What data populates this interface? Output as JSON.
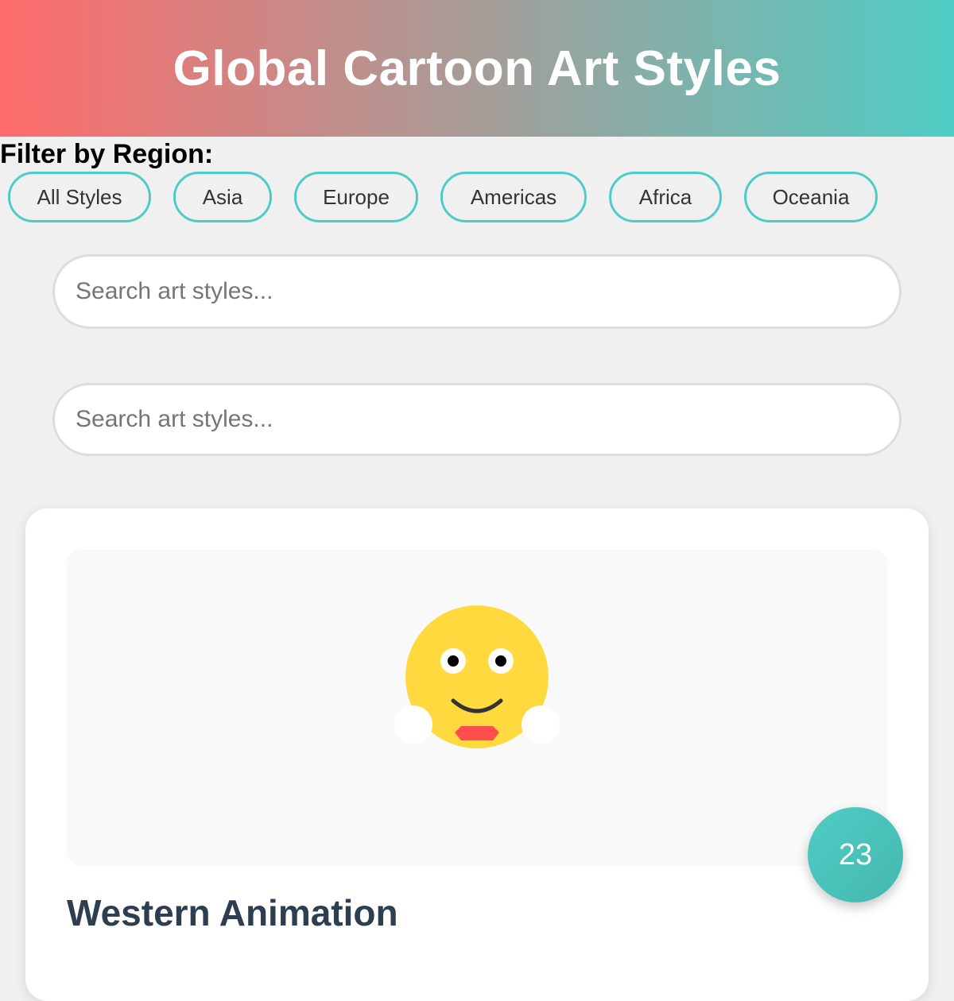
{
  "header": {
    "title": "Global Cartoon Art Styles"
  },
  "filter": {
    "title": "Filter by Region:",
    "buttons": [
      "All Styles",
      "Asia",
      "Europe",
      "Americas",
      "Africa",
      "Oceania"
    ]
  },
  "search": {
    "placeholder_1": "Search art styles...",
    "placeholder_2": "Search art styles..."
  },
  "card": {
    "title": "Western Animation",
    "illustration": "smiley-face-icon"
  },
  "floating_badge": {
    "count": "23"
  },
  "colors": {
    "header_gradient_start": "#ff6b6b",
    "header_gradient_end": "#4ecdc4",
    "accent": "#4ecdc4",
    "card_title": "#2c3e50",
    "face": "#ffd93d",
    "mouth": "#ff4d4d"
  }
}
